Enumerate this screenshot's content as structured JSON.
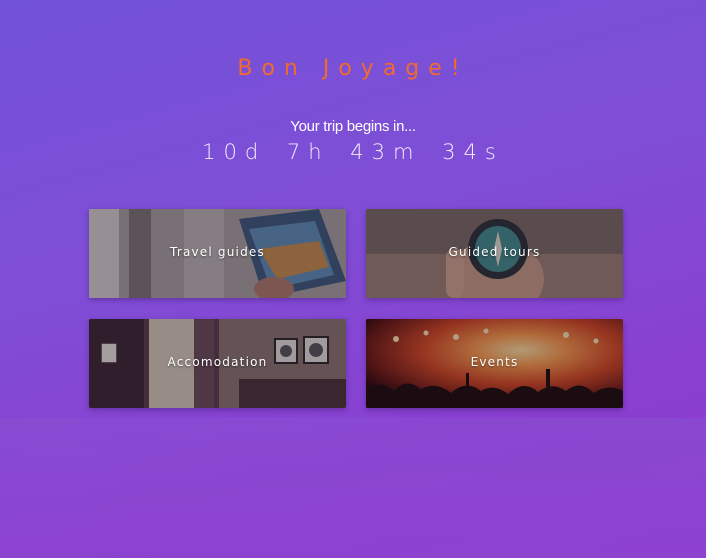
{
  "header": {
    "title": "Bon Joyage!",
    "subtitle": "Your trip begins in...",
    "countdown": {
      "days": "10d",
      "hours": "7h",
      "minutes": "43m",
      "seconds": "34s"
    }
  },
  "cards": [
    {
      "label": "Travel guides"
    },
    {
      "label": "Guided tours"
    },
    {
      "label": "Accomodation"
    },
    {
      "label": "Events"
    }
  ],
  "colors": {
    "title": "#f06a2e",
    "background_top": "#7252d8",
    "background_bottom": "#8d3cce"
  }
}
